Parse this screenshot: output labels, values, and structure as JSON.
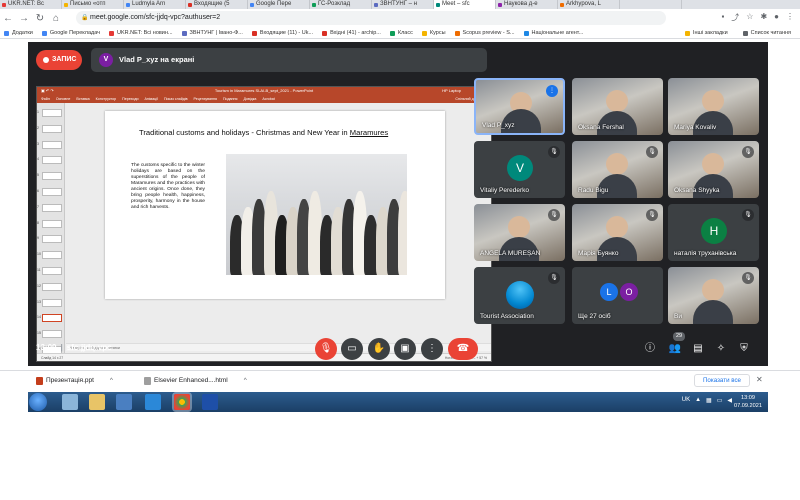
{
  "browser": {
    "tabs": [
      {
        "label": "UKR.NET: Вс",
        "color": "#e53935"
      },
      {
        "label": "Письмо «отп",
        "color": "#f4b400"
      },
      {
        "label": "Ludmyla Arn",
        "color": "#4285f4"
      },
      {
        "label": "Входящие (5",
        "color": "#d93025"
      },
      {
        "label": "Google Пере",
        "color": "#4285f4"
      },
      {
        "label": "ГС-Розклад",
        "color": "#0f9d58"
      },
      {
        "label": "ЗВНТУНГ – н",
        "color": "#5c6bc0"
      },
      {
        "label": "Meet – sfc",
        "color": "#00897b",
        "active": true
      },
      {
        "label": "Наукова д-е",
        "color": "#8e24aa"
      },
      {
        "label": "Arkhypova, L",
        "color": "#ef6c00"
      }
    ],
    "url": "meet.google.com/sfc-jjdq-vpc?authuser=2",
    "bookmarks": [
      {
        "label": "Додатки",
        "color": "#4285f4"
      },
      {
        "label": "Google Перекладач",
        "color": "#4285f4"
      },
      {
        "label": "UKR.NET: Всі новин...",
        "color": "#e53935"
      },
      {
        "label": "ЗВНТУНГ | Івано-Ф...",
        "color": "#5c6bc0"
      },
      {
        "label": "Входящие (11) - Uk...",
        "color": "#d93025"
      },
      {
        "label": "Вхідні (41) - archip...",
        "color": "#d93025"
      },
      {
        "label": "Класс",
        "color": "#0f9d58"
      },
      {
        "label": "Курсы",
        "color": "#f4b400"
      },
      {
        "label": "Scopus preview - S...",
        "color": "#ef6c00"
      },
      {
        "label": "Національне агент...",
        "color": "#1e88e5"
      }
    ],
    "bookmarks_right": [
      "Інші закладки",
      "Список читання"
    ]
  },
  "meet": {
    "rec_label": "ЗАПИС",
    "presenting": {
      "initial": "V",
      "label": "Vlad P_xyz на екрані"
    },
    "ppt": {
      "window_title": "Tourism in Maramures SLAI-B_sept_2021 - PowerPoint",
      "user": "HP Laptop",
      "tell_me": "Скажіть мені що ви бажаєте зробити",
      "ribbon": [
        "Файл",
        "Основне",
        "Вставка",
        "Конструктор",
        "Переходи",
        "Анімації",
        "Показ слайдів",
        "Рецензування",
        "Подання",
        "Довідка",
        "Acrobat"
      ],
      "share": "Спільний доступ",
      "slide_numbers": [
        "1",
        "2",
        "3",
        "4",
        "5",
        "6",
        "7",
        "8",
        "9",
        "10",
        "11",
        "12",
        "13",
        "14",
        "15",
        "16"
      ],
      "selected_slide": "14",
      "slide_title_main": "Traditional customs and holidays - Christmas and New Year in ",
      "slide_title_place": "Maramures",
      "slide_text": "The customs specific to the winter holidays are based on the superstitions of the people of Maramures and the practices with ancient origins. Once done, they bring people health, happiness, prosperity, harmony in the house and rich harvests.",
      "notes": "Клацніть, щоб додати нотатки",
      "status_left": "Слайд 14 з 27",
      "status_right": "Нотатки   Примітки   –   +   57 %"
    },
    "participants": [
      {
        "name": "Vlad P_xyz",
        "type": "video",
        "speaking": true
      },
      {
        "name": "Oksana Fershal",
        "type": "video"
      },
      {
        "name": "Mariya Kovaliv",
        "type": "video"
      },
      {
        "name": "Vitaliy Perederko",
        "type": "avatar",
        "initial": "V",
        "color": "#00897b",
        "muted": true
      },
      {
        "name": "Radu Bigu",
        "type": "video",
        "muted": true
      },
      {
        "name": "Oksana Shyyka",
        "type": "video",
        "muted": true
      },
      {
        "name": "ANGELA MUREȘAN",
        "type": "video",
        "muted": true
      },
      {
        "name": "Марія Буянко",
        "type": "video",
        "muted": true
      },
      {
        "name": "наталія труханівська",
        "type": "avatar",
        "initial": "Н",
        "color": "#0b8043",
        "muted": true
      },
      {
        "name": "Tourist Association",
        "type": "logo",
        "muted": true
      },
      {
        "name": "Ще 27 осіб",
        "type": "more",
        "initials": [
          "L",
          "O"
        ],
        "colors": [
          "#1a73e8",
          "#7b1fa2"
        ]
      },
      {
        "name": "Ви",
        "type": "video",
        "muted": true
      }
    ],
    "time": "13:09",
    "meeting_code": "sfc-jjdq-vpc",
    "people_count": "29"
  },
  "downloads": [
    {
      "label": "Презентація.ppt",
      "color": "#c43e1c"
    },
    {
      "label": "Elsevier Enhanced....html",
      "color": "#9e9e9e"
    }
  ],
  "show_all": "Показати все",
  "taskbar": {
    "lang": "UK",
    "time": "13:09",
    "date": "07.09.2021"
  }
}
